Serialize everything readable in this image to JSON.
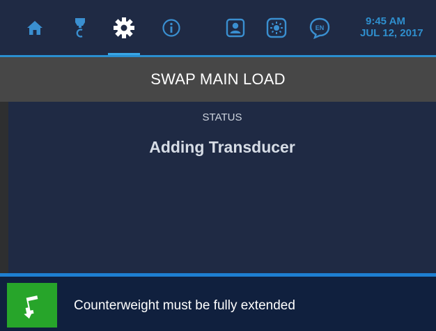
{
  "nav": {
    "items": [
      {
        "name": "home",
        "icon": "home-icon",
        "active": false
      },
      {
        "name": "probe",
        "icon": "probe-icon",
        "active": false
      },
      {
        "name": "settings",
        "icon": "gear-icon",
        "active": true
      },
      {
        "name": "info",
        "icon": "info-icon",
        "active": false
      },
      {
        "name": "user",
        "icon": "user-icon",
        "active": false
      },
      {
        "name": "brightness",
        "icon": "brightness-icon",
        "active": false
      },
      {
        "name": "language",
        "icon": "language-icon",
        "label": "EN",
        "active": false
      }
    ],
    "time": "9:45 AM",
    "date": "JUL 12, 2017"
  },
  "title": "SWAP MAIN LOAD",
  "status": {
    "label": "STATUS",
    "value": "Adding Transducer"
  },
  "message": {
    "icon": "arrow-icon",
    "text": "Counterweight must be fully extended"
  },
  "colors": {
    "bar_bg": "#1f2a44",
    "accent": "#2a8fd0",
    "icon_blue": "#3a8fd0",
    "title_bg": "#474747",
    "message_bg": "#10203e",
    "message_icon_bg": "#27a52a"
  }
}
